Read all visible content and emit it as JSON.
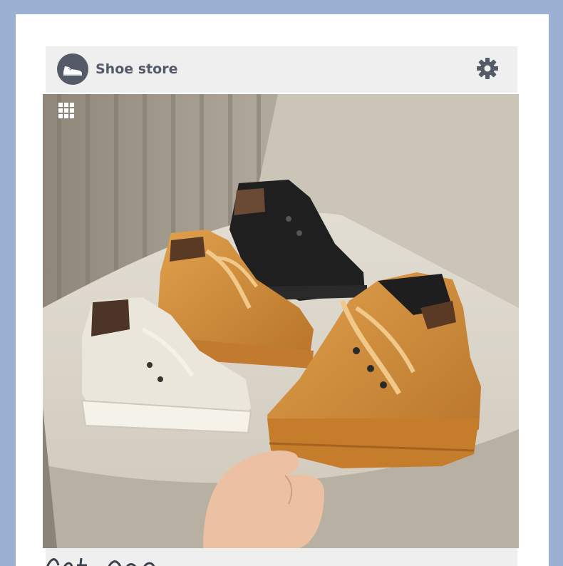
{
  "header": {
    "title": "Shoe store",
    "logo_icon": "sneaker-icon",
    "settings_icon": "gear-icon"
  },
  "photo": {
    "overlay_icon": "grid-icon",
    "description_colors": {
      "background_wall": "#b9b2a6",
      "chair": "#d8d2c6",
      "boot_tan": "#d08b35",
      "boot_white": "#ece8df",
      "boot_black": "#1e1e1f"
    }
  },
  "colors": {
    "page_background": "#9bb0d2",
    "header_background": "#efefef",
    "brand_text": "#545a68"
  }
}
